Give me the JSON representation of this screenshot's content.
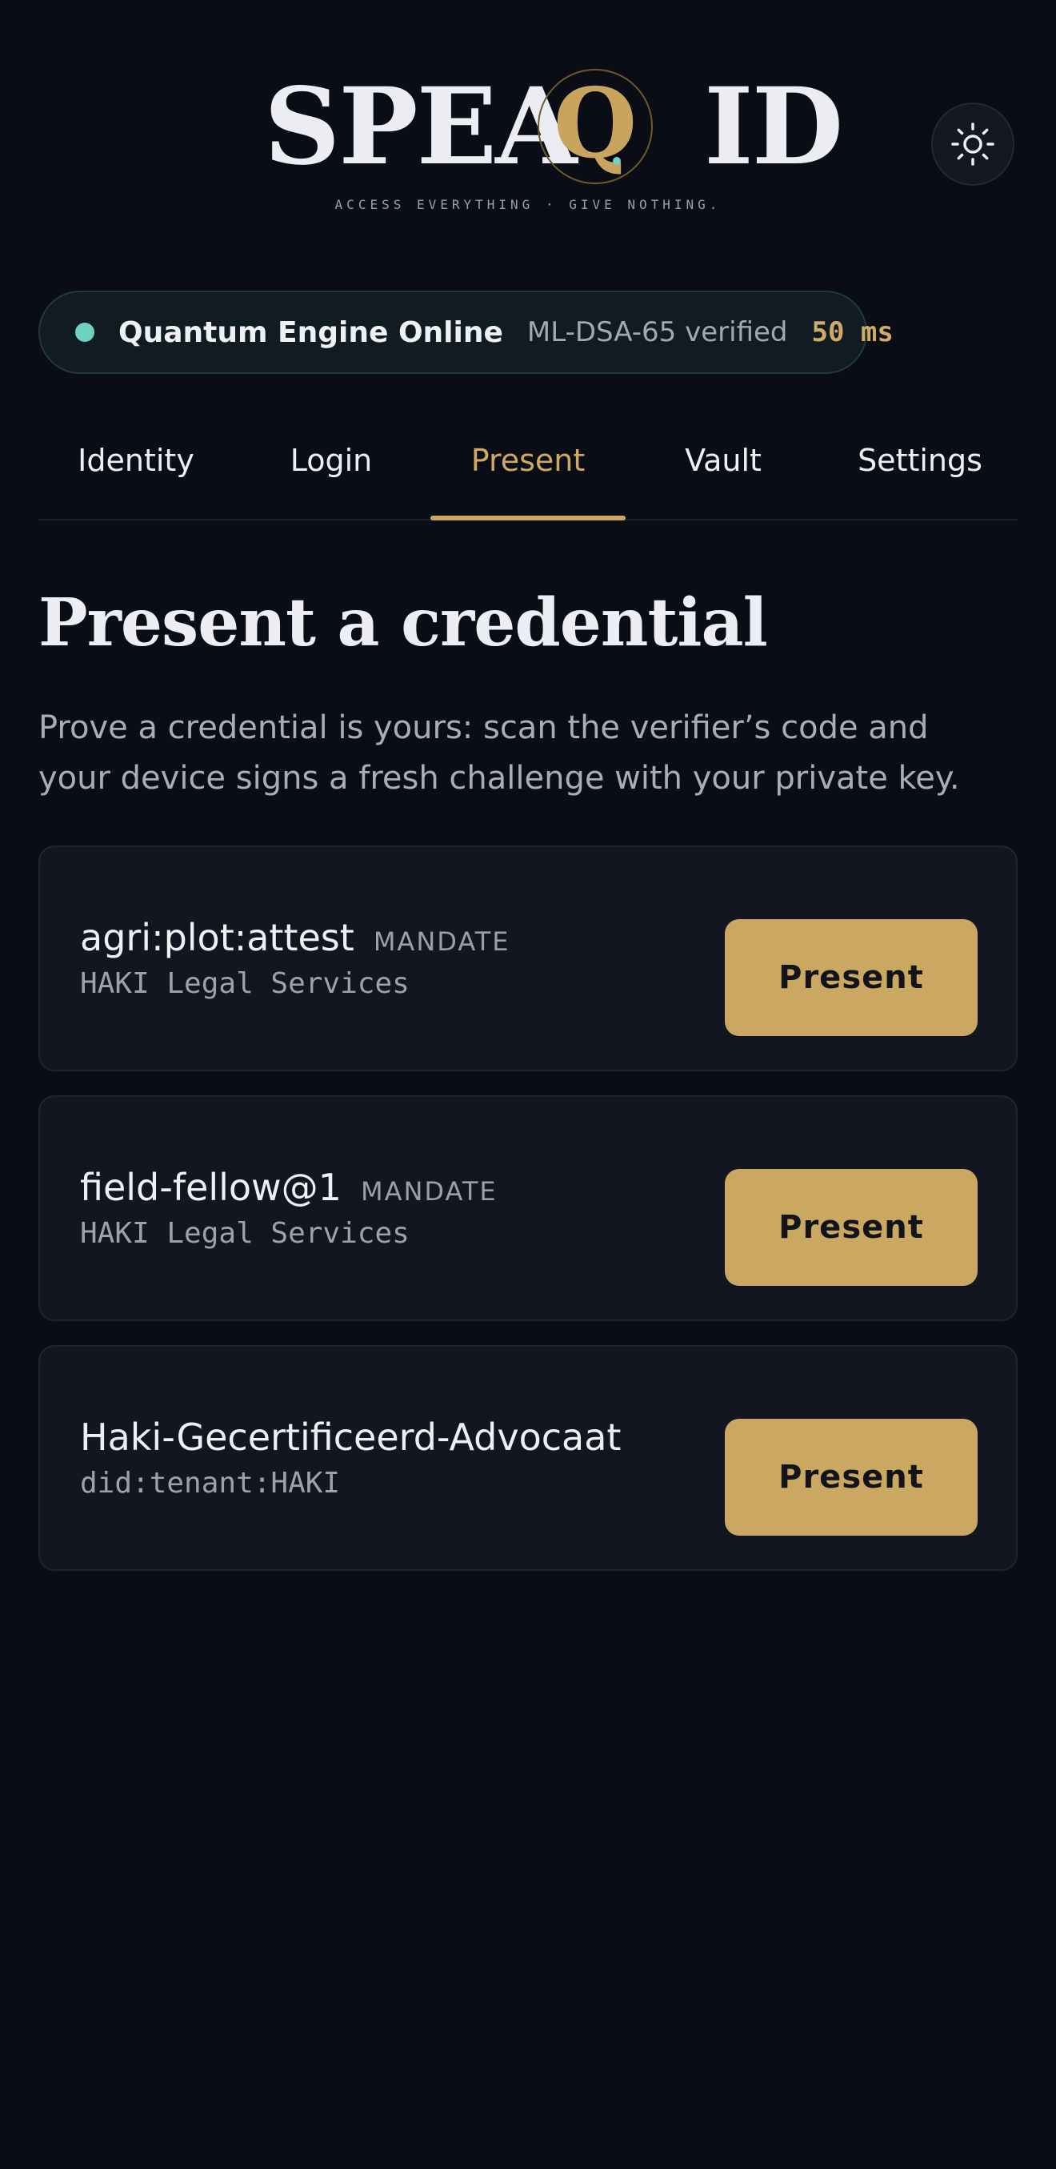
{
  "header": {
    "logo_left": "SPEA",
    "logo_q": "Q",
    "logo_right": "ID",
    "tagline": "ACCESS EVERYTHING · GIVE NOTHING.",
    "theme_icon": "sun-icon"
  },
  "status": {
    "online_label": "Quantum Engine Online",
    "verified_label": "ML-DSA-65 verified",
    "latency": "50 ms",
    "dot_color": "#6fd1bf"
  },
  "tabs": [
    {
      "label": "Identity",
      "active": false
    },
    {
      "label": "Login",
      "active": false
    },
    {
      "label": "Present",
      "active": true
    },
    {
      "label": "Vault",
      "active": false
    },
    {
      "label": "Settings",
      "active": false
    }
  ],
  "main": {
    "title": "Present a credential",
    "description": "Prove a credential is yours: scan the verifier’s code and your device signs a fresh challenge with your private key."
  },
  "credentials": [
    {
      "name": "agri:plot:attest",
      "tag": "MANDATE",
      "issuer": "HAKI Legal Services",
      "button": "Present"
    },
    {
      "name": "field-fellow@1",
      "tag": "MANDATE",
      "issuer": "HAKI Legal Services",
      "button": "Present"
    },
    {
      "name": "Haki-Gecertificeerd-Advocaat",
      "tag": "",
      "issuer": "did:tenant:HAKI",
      "button": "Present"
    }
  ],
  "colors": {
    "accent": "#cba862",
    "background": "#0a0d16",
    "status_ok": "#6fd1bf"
  }
}
